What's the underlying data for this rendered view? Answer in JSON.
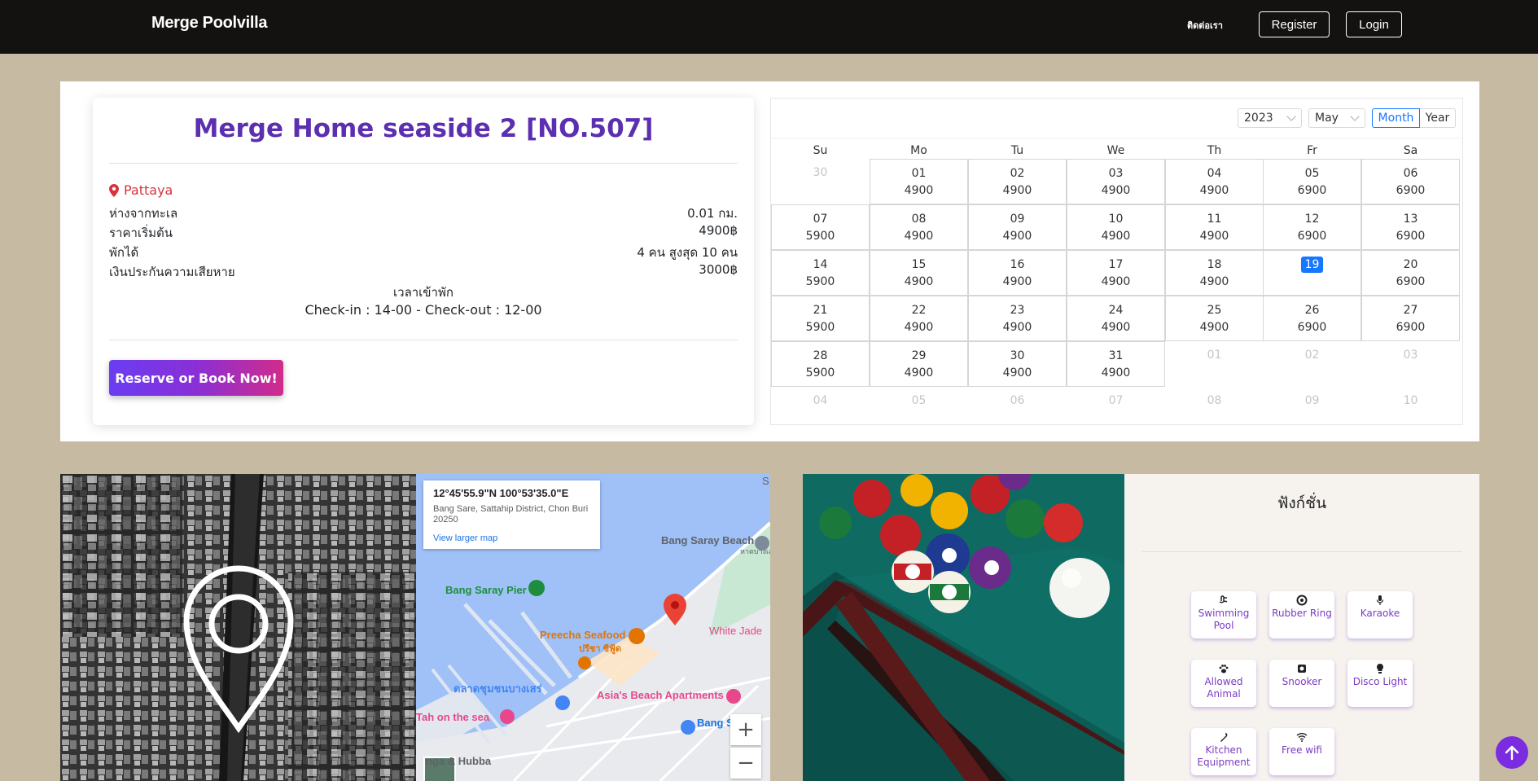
{
  "navbar": {
    "brand": "Merge Poolvilla",
    "contact": "ติดต่อเรา",
    "register": "Register",
    "login": "Login"
  },
  "property": {
    "title": "Merge Home seaside 2 [NO.507]",
    "location": "Pattaya",
    "rows": [
      {
        "label": "ห่างจากทะเล",
        "value": "0.01 กม."
      },
      {
        "label": "ราคาเริ่มต้น",
        "value": "4900฿"
      },
      {
        "label": "พักได้",
        "value": "4 คน สูงสุด 10 คน"
      },
      {
        "label": "เงินประกันความเสียหาย",
        "value": "3000฿"
      }
    ],
    "checkin_label": "เวลาเข้าพัก",
    "checkin_time": "Check-in : 14-00 - Check-out : 12-00",
    "book_button": "Reserve or Book Now!"
  },
  "calendar": {
    "year": "2023",
    "month": "May",
    "mode_month": "Month",
    "mode_year": "Year",
    "weekdays": [
      "Su",
      "Mo",
      "Tu",
      "We",
      "Th",
      "Fr",
      "Sa"
    ],
    "weeks": [
      [
        {
          "d": "30",
          "p": "",
          "m": true
        },
        {
          "d": "01",
          "p": "4900"
        },
        {
          "d": "02",
          "p": "4900"
        },
        {
          "d": "03",
          "p": "4900"
        },
        {
          "d": "04",
          "p": "4900"
        },
        {
          "d": "05",
          "p": "6900"
        },
        {
          "d": "06",
          "p": "6900"
        }
      ],
      [
        {
          "d": "07",
          "p": "5900"
        },
        {
          "d": "08",
          "p": "4900"
        },
        {
          "d": "09",
          "p": "4900"
        },
        {
          "d": "10",
          "p": "4900"
        },
        {
          "d": "11",
          "p": "4900"
        },
        {
          "d": "12",
          "p": "6900"
        },
        {
          "d": "13",
          "p": "6900"
        }
      ],
      [
        {
          "d": "14",
          "p": "5900"
        },
        {
          "d": "15",
          "p": "4900"
        },
        {
          "d": "16",
          "p": "4900"
        },
        {
          "d": "17",
          "p": "4900"
        },
        {
          "d": "18",
          "p": "4900"
        },
        {
          "d": "19",
          "p": "",
          "today": true
        },
        {
          "d": "20",
          "p": "6900"
        }
      ],
      [
        {
          "d": "21",
          "p": "5900"
        },
        {
          "d": "22",
          "p": "4900"
        },
        {
          "d": "23",
          "p": "4900"
        },
        {
          "d": "24",
          "p": "4900"
        },
        {
          "d": "25",
          "p": "4900"
        },
        {
          "d": "26",
          "p": "6900"
        },
        {
          "d": "27",
          "p": "6900"
        }
      ],
      [
        {
          "d": "28",
          "p": "5900"
        },
        {
          "d": "29",
          "p": "4900"
        },
        {
          "d": "30",
          "p": "4900"
        },
        {
          "d": "31",
          "p": "4900"
        },
        {
          "d": "01",
          "p": "",
          "m": true
        },
        {
          "d": "02",
          "p": "",
          "m": true
        },
        {
          "d": "03",
          "p": "",
          "m": true
        }
      ],
      [
        {
          "d": "04",
          "p": "",
          "m": true
        },
        {
          "d": "05",
          "p": "",
          "m": true
        },
        {
          "d": "06",
          "p": "",
          "m": true
        },
        {
          "d": "07",
          "p": "",
          "m": true
        },
        {
          "d": "08",
          "p": "",
          "m": true
        },
        {
          "d": "09",
          "p": "",
          "m": true
        },
        {
          "d": "10",
          "p": "",
          "m": true
        }
      ]
    ]
  },
  "map": {
    "coordinates": "12°45'55.9\"N 100°53'35.0\"E",
    "address": "Bang Sare, Sattahip District, Chon Buri 20250",
    "larger_map": "View larger map",
    "labels": [
      "Bang Saray Beach",
      "หาดบางเสร่",
      "Bang Saray Pier",
      "Preecha Seafood",
      "ปรีชา ซีฟู้ด",
      "White Jade",
      "ตลาดชุมชนบางเสร่",
      "Asia's Beach Apartments",
      "Tah on the sea",
      "Bang S",
      "nga & Hubba",
      "S"
    ]
  },
  "functions": {
    "title": "ฟังก์ชั่น",
    "items": [
      {
        "label": "Swimming Pool",
        "icon": "swimming-icon"
      },
      {
        "label": "Rubber Ring",
        "icon": "ring-icon"
      },
      {
        "label": "Karaoke",
        "icon": "microphone-icon"
      },
      {
        "label": "Allowed Animal",
        "icon": "paw-icon"
      },
      {
        "label": "Snooker",
        "icon": "snooker-icon"
      },
      {
        "label": "Disco Light",
        "icon": "light-icon"
      },
      {
        "label": "Kitchen Equipment",
        "icon": "kitchen-icon"
      },
      {
        "label": "Free wifi",
        "icon": "wifi-icon"
      }
    ]
  },
  "colors": {
    "accent": "#5b2fb0",
    "today": "#1677ff",
    "location": "#d6343c"
  }
}
